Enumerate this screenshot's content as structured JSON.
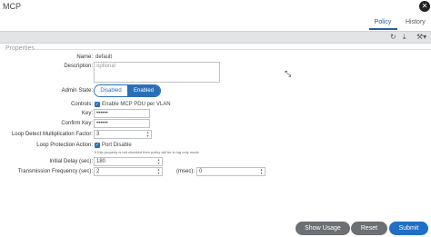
{
  "window": {
    "title": "MCP"
  },
  "tabs": {
    "policy": "Policy",
    "history": "History"
  },
  "toolbar": {
    "refresh_icon": "refresh-icon",
    "download_icon": "download-icon",
    "tools_icon": "tools-icon"
  },
  "section": {
    "title": "Properties"
  },
  "form": {
    "name_label": "Name:",
    "name_value": "default",
    "description_label": "Description:",
    "description_placeholder": "optional",
    "admin_state_label": "Admin State:",
    "admin_state_disabled": "Disabled",
    "admin_state_enabled": "Enabled",
    "controls_label": "Controls:",
    "controls_option": "Enable MCP PDU per VLAN",
    "key_label": "Key:",
    "key_value": "••••••",
    "confirm_key_label": "Confirm Key:",
    "confirm_key_value": "••••••",
    "loop_factor_label": "Loop Detect Multiplication Factor:",
    "loop_factor_value": "3",
    "loop_action_label": "Loop Protection Action:",
    "loop_action_option": "Port Disable",
    "loop_action_note": "If this property is not checked then policy will be in log only mode.",
    "initial_delay_label": "Initial Delay (sec):",
    "initial_delay_value": "180",
    "tx_freq_label": "Transmission Frequency (sec):",
    "tx_freq_value": "2",
    "msec_label": "(msec):",
    "msec_value": "0"
  },
  "buttons": {
    "show_usage": "Show Usage",
    "reset": "Reset",
    "submit": "Submit"
  },
  "colors": {
    "accent": "#2a6fb5",
    "submit": "#1f6fc6",
    "secondary_button": "#6c6f73",
    "toolbar_bg": "#e2e4e6"
  }
}
